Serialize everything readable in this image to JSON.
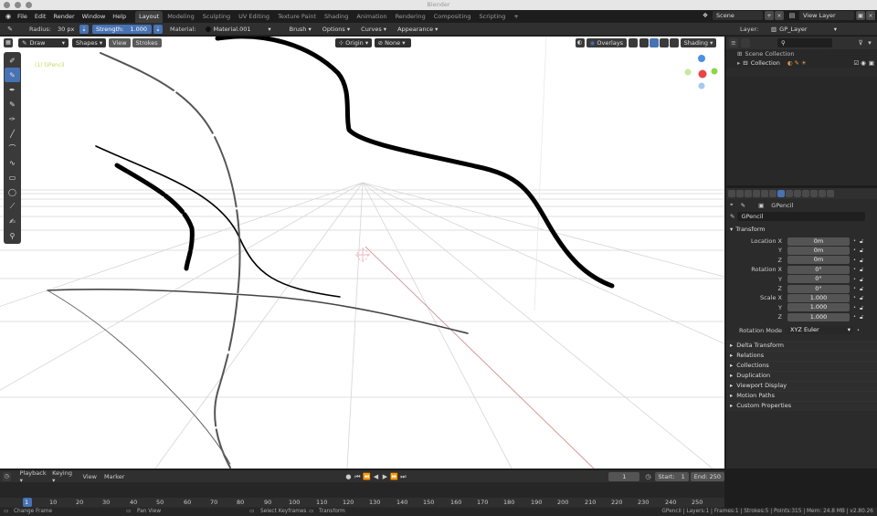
{
  "window": {
    "title": "Blender"
  },
  "menus": [
    "File",
    "Edit",
    "Render",
    "Window",
    "Help"
  ],
  "workspaces": [
    "Layout",
    "Modeling",
    "Sculpting",
    "UV Editing",
    "Texture Paint",
    "Shading",
    "Animation",
    "Rendering",
    "Compositing",
    "Scripting"
  ],
  "active_workspace": "Layout",
  "add_workspace": "+",
  "scene": {
    "label": "Scene",
    "view_layer": "View Layer"
  },
  "tool_header": {
    "radius_label": "Radius:",
    "radius_value": "30 px",
    "strength_label": "Strength:",
    "strength_value": "1.000",
    "material_label": "Material:",
    "material_value": "Material.001",
    "brush": "Brush",
    "options": "Options",
    "curves": "Curves",
    "appearance": "Appearance",
    "layer_label": "Layer:",
    "layer_value": "GP_Layer"
  },
  "viewport_header": {
    "mode": "Draw",
    "shapes": "Shapes",
    "view": "View",
    "strokes": "Strokes",
    "origin": "Origin",
    "none": "None",
    "overlays": "Overlays",
    "shading": "Shading"
  },
  "viewport": {
    "object_label": "(1) GPencil"
  },
  "outliner": {
    "scene_collection": "Scene Collection",
    "collection": "Collection"
  },
  "properties": {
    "object_name": "GPencil",
    "datablock": "GPencil",
    "transform_title": "Transform",
    "rows": [
      {
        "label": "Location X",
        "value": "0m"
      },
      {
        "label": "Y",
        "value": "0m"
      },
      {
        "label": "Z",
        "value": "0m"
      },
      {
        "label": "Rotation X",
        "value": "0°"
      },
      {
        "label": "Y",
        "value": "0°"
      },
      {
        "label": "Z",
        "value": "0°"
      },
      {
        "label": "Scale X",
        "value": "1.000"
      },
      {
        "label": "Y",
        "value": "1.000"
      },
      {
        "label": "Z",
        "value": "1.000"
      }
    ],
    "rotation_mode_label": "Rotation Mode",
    "rotation_mode_value": "XYZ Euler",
    "panels": [
      "Delta Transform",
      "Relations",
      "Collections",
      "Duplication",
      "Viewport Display",
      "Motion Paths",
      "Custom Properties"
    ]
  },
  "timeline": {
    "playback": "Playback",
    "keying": "Keying",
    "view": "View",
    "marker": "Marker",
    "current_frame": "1",
    "start_label": "Start:",
    "start_value": "1",
    "end_label": "End:",
    "end_value": "250",
    "ruler": [
      "1",
      "10",
      "20",
      "30",
      "40",
      "50",
      "60",
      "70",
      "80",
      "90",
      "100",
      "110",
      "120",
      "130",
      "140",
      "150",
      "160",
      "170",
      "180",
      "190",
      "200",
      "210",
      "220",
      "230",
      "240",
      "250"
    ]
  },
  "status": {
    "change_frame": "Change Frame",
    "pan_view": "Pan View",
    "select_keyframes": "Select Keyframes",
    "transform": "Transform",
    "stats": "GPencil | Layers:1 | Frames:1 | Strokes:5 | Points:315 | Mem: 24.8 MB | v2.80.26"
  },
  "colors": {
    "accent": "#4772b3",
    "active_tab": "#3d3d3d",
    "axis_x": "#e44",
    "axis_y": "#8c4",
    "axis_z": "#48e"
  }
}
